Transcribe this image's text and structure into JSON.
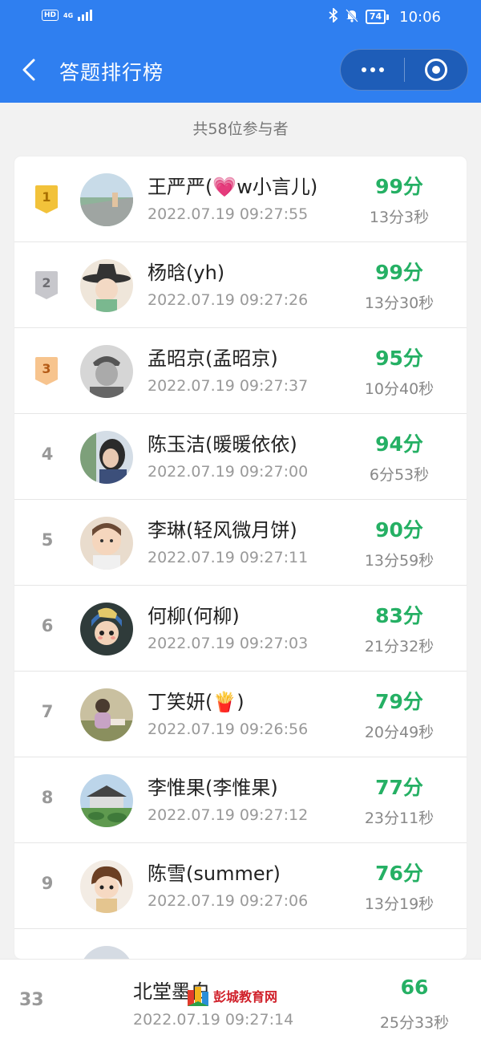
{
  "status_bar": {
    "hd": "HD",
    "network": "4G",
    "battery": "74",
    "time": "10:06"
  },
  "nav": {
    "title": "答题排行榜"
  },
  "summary": {
    "participants": "共58位参与者"
  },
  "colors": {
    "primary": "#2f7ff0",
    "score": "#25b064",
    "gold": "#f2c23a",
    "silver": "#c7c7cc",
    "bronze": "#f7c48e"
  },
  "icons": {
    "back": "back-arrow-icon",
    "more": "more-dots-icon",
    "close": "mini-program-close-icon",
    "bluetooth": "bluetooth-icon",
    "mute": "bell-mute-icon"
  },
  "rows": [
    {
      "rank": "1",
      "name": "王严严(💗w小言儿)",
      "time": "2022.07.19 09:27:55",
      "score": "99分",
      "duration": "13分3秒"
    },
    {
      "rank": "2",
      "name": "杨晗(yh)",
      "time": "2022.07.19 09:27:26",
      "score": "99分",
      "duration": "13分30秒"
    },
    {
      "rank": "3",
      "name": "孟昭京(孟昭京)",
      "time": "2022.07.19 09:27:37",
      "score": "95分",
      "duration": "10分40秒"
    },
    {
      "rank": "4",
      "name": "陈玉洁(暖暖依依)",
      "time": "2022.07.19 09:27:00",
      "score": "94分",
      "duration": "6分53秒"
    },
    {
      "rank": "5",
      "name": "李琳(轻风微月饼)",
      "time": "2022.07.19 09:27:11",
      "score": "90分",
      "duration": "13分59秒"
    },
    {
      "rank": "6",
      "name": "何柳(何柳)",
      "time": "2022.07.19 09:27:03",
      "score": "83分",
      "duration": "21分32秒"
    },
    {
      "rank": "7",
      "name": "丁笑妍(🍟)",
      "time": "2022.07.19 09:26:56",
      "score": "79分",
      "duration": "20分49秒"
    },
    {
      "rank": "8",
      "name": "李惟果(李惟果)",
      "time": "2022.07.19 09:27:12",
      "score": "77分",
      "duration": "23分11秒"
    },
    {
      "rank": "9",
      "name": "陈雪(summer)",
      "time": "2022.07.19 09:27:06",
      "score": "76分",
      "duration": "13分19秒"
    }
  ],
  "me": {
    "rank": "33",
    "name": "北堂墨白",
    "time": "2022.07.19 09:27:14",
    "score": "66",
    "duration": "25分33秒"
  },
  "watermark": {
    "text": "彭城教育网"
  }
}
